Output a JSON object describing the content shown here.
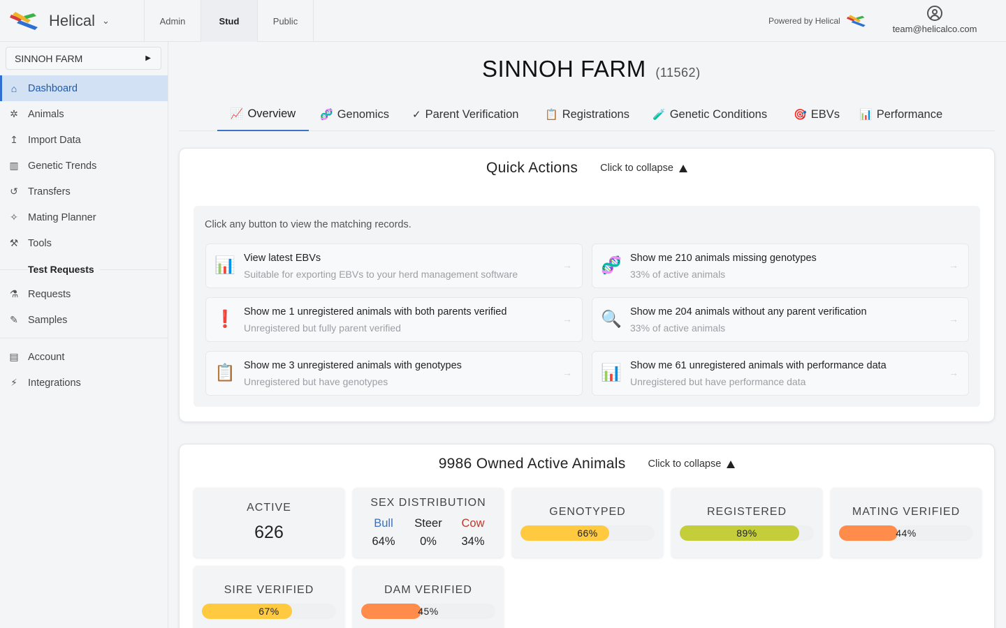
{
  "brand": {
    "name": "Helical"
  },
  "top_tabs": [
    {
      "label": "Admin"
    },
    {
      "label": "Stud"
    },
    {
      "label": "Public"
    }
  ],
  "powered_by": "Powered by Helical",
  "user": {
    "email": "team@helicalco.com"
  },
  "sidebar": {
    "farm_selector": "SINNOH FARM",
    "items": [
      {
        "label": "Dashboard",
        "icon": "home-icon"
      },
      {
        "label": "Animals",
        "icon": "cow-icon"
      },
      {
        "label": "Import Data",
        "icon": "upload-icon"
      },
      {
        "label": "Genetic Trends",
        "icon": "bar-chart-icon"
      },
      {
        "label": "Transfers",
        "icon": "history-icon"
      },
      {
        "label": "Mating Planner",
        "icon": "sparkle-icon"
      },
      {
        "label": "Tools",
        "icon": "tools-icon"
      }
    ],
    "section_test_requests": "Test Requests",
    "test_items": [
      {
        "label": "Requests",
        "icon": "flask-icon"
      },
      {
        "label": "Samples",
        "icon": "pipette-icon"
      }
    ],
    "bottom_items": [
      {
        "label": "Account",
        "icon": "account-card-icon"
      },
      {
        "label": "Integrations",
        "icon": "plug-icon"
      }
    ]
  },
  "page": {
    "title": "SINNOH FARM",
    "farm_id": "(11562)"
  },
  "tabs": [
    {
      "label": "Overview",
      "icon": "📈"
    },
    {
      "label": "Genomics",
      "icon": "🧬"
    },
    {
      "label": "Parent Verification",
      "icon": "✓"
    },
    {
      "label": "Registrations",
      "icon": "📋"
    },
    {
      "label": "Genetic Conditions",
      "icon": "🧪"
    },
    {
      "label": "EBVs",
      "icon": "🎯"
    },
    {
      "label": "Performance",
      "icon": "📊"
    }
  ],
  "quick_actions": {
    "title": "Quick Actions",
    "collapse_label": "Click to collapse",
    "hint": "Click any button to view the matching records.",
    "buttons": [
      {
        "title": "View latest EBVs",
        "subtitle": "Suitable for exporting EBVs to your herd management software",
        "icon": "📊"
      },
      {
        "title": "Show me 210 animals missing genotypes",
        "subtitle": "33% of active animals",
        "icon": "🧬"
      },
      {
        "title": "Show me 1 unregistered animals with both parents verified",
        "subtitle": "Unregistered but fully parent verified",
        "icon": "❗"
      },
      {
        "title": "Show me 204 animals without any parent verification",
        "subtitle": "33% of active animals",
        "icon": "🔍"
      },
      {
        "title": "Show me 3 unregistered animals with genotypes",
        "subtitle": "Unregistered but have genotypes",
        "icon": "📋"
      },
      {
        "title": "Show me 61 unregistered animals with performance data",
        "subtitle": "Unregistered but have performance data",
        "icon": "📊"
      }
    ],
    "arrow": "→"
  },
  "owned": {
    "title": "9986 Owned Active Animals",
    "collapse_label": "Click to collapse",
    "active": {
      "label": "ACTIVE",
      "value": "626"
    },
    "sex": {
      "label": "SEX DISTRIBUTION",
      "bull_label": "Bull",
      "bull_value": "64%",
      "steer_label": "Steer",
      "steer_value": "0%",
      "cow_label": "Cow",
      "cow_value": "34%",
      "bull_color": "#3b6fc4",
      "cow_color": "#c0392b"
    },
    "bars": [
      {
        "label": "GENOTYPED",
        "text": "66%",
        "fraction": 0.66,
        "color": "#ffc940"
      },
      {
        "label": "REGISTERED",
        "text": "89%",
        "fraction": 0.89,
        "color": "#c4cd3a"
      },
      {
        "label": "MATING VERIFIED",
        "text": "44%",
        "fraction": 0.44,
        "color": "#ff8c4a"
      },
      {
        "label": "SIRE VERIFIED",
        "text": "67%",
        "fraction": 0.67,
        "color": "#ffc940"
      },
      {
        "label": "DAM VERIFIED",
        "text": "45%",
        "fraction": 0.45,
        "color": "#ff8c4a"
      }
    ]
  }
}
